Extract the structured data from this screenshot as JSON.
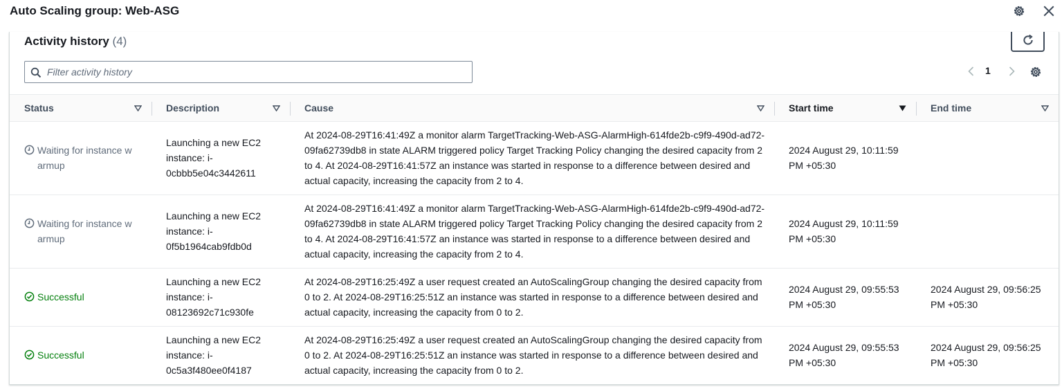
{
  "window": {
    "title": "Auto Scaling group: Web-ASG"
  },
  "panel": {
    "title": "Activity history",
    "count": "(4)"
  },
  "filter": {
    "placeholder": "Filter activity history",
    "value": ""
  },
  "pagination": {
    "current_page": "1"
  },
  "columns": [
    "Status",
    "Description",
    "Cause",
    "Start time",
    "End time"
  ],
  "rows": [
    {
      "status": "Waiting for instance w armup",
      "status_type": "pending",
      "description": "Launching a new EC2 instance: i-0cbbb5e04c3442611",
      "cause": "At 2024-08-29T16:41:49Z a monitor alarm TargetTracking-Web-ASG-AlarmHigh-614fde2b-c9f9-490d-ad72-09fa62739db8 in state ALARM triggered policy Target Tracking Policy changing the desired capacity from 2 to 4. At 2024-08-29T16:41:57Z an instance was started in response to a difference between desired and actual capacity, increasing the capacity from 2 to 4.",
      "start_time": "2024 August 29, 10:11:59 PM +05:30",
      "end_time": ""
    },
    {
      "status": "Waiting for instance w armup",
      "status_type": "pending",
      "description": "Launching a new EC2 instance: i-0f5b1964cab9fdb0d",
      "cause": "At 2024-08-29T16:41:49Z a monitor alarm TargetTracking-Web-ASG-AlarmHigh-614fde2b-c9f9-490d-ad72-09fa62739db8 in state ALARM triggered policy Target Tracking Policy changing the desired capacity from 2 to 4. At 2024-08-29T16:41:57Z an instance was started in response to a difference between desired and actual capacity, increasing the capacity from 2 to 4.",
      "start_time": "2024 August 29, 10:11:59 PM +05:30",
      "end_time": ""
    },
    {
      "status": "Successful",
      "status_type": "success",
      "description": "Launching a new EC2 instance: i-08123692c71c930fe",
      "cause": "At 2024-08-29T16:25:49Z a user request created an AutoScalingGroup changing the desired capacity from 0 to 2. At 2024-08-29T16:25:51Z an instance was started in response to a difference between desired and actual capacity, increasing the capacity from 0 to 2.",
      "start_time": "2024 August 29, 09:55:53 PM +05:30",
      "end_time": "2024 August 29, 09:56:25 PM +05:30"
    },
    {
      "status": "Successful",
      "status_type": "success",
      "description": "Launching a new EC2 instance: i-0c5a3f480ee0f4187",
      "cause": "At 2024-08-29T16:25:49Z a user request created an AutoScalingGroup changing the desired capacity from 0 to 2. At 2024-08-29T16:25:51Z an instance was started in response to a difference between desired and actual capacity, increasing the capacity from 0 to 2.",
      "start_time": "2024 August 29, 09:55:53 PM +05:30",
      "end_time": "2024 August 29, 09:56:25 PM +05:30"
    }
  ],
  "icons": {
    "settings": "gear-icon",
    "close": "close-icon",
    "refresh": "refresh-icon",
    "search": "search-icon",
    "prev": "chevron-left-icon",
    "next": "chevron-right-icon",
    "sort": "sort-triangle-icon",
    "pending_status": "clock-icon",
    "success_status": "check-circle-icon"
  },
  "colors": {
    "success": "#037f0c",
    "pending": "#5f6b7a",
    "text": "#16191f"
  }
}
